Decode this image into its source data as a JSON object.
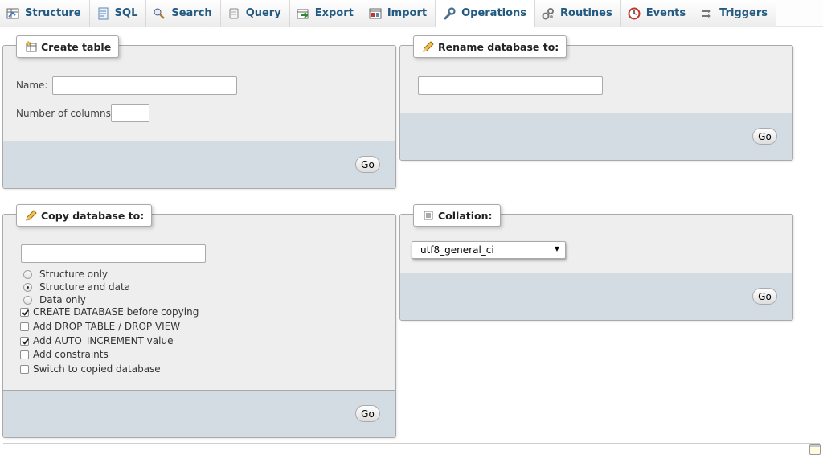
{
  "tabs": [
    {
      "label": "Structure",
      "icon": "structure-icon"
    },
    {
      "label": "SQL",
      "icon": "sql-icon"
    },
    {
      "label": "Search",
      "icon": "search-icon"
    },
    {
      "label": "Query",
      "icon": "query-icon"
    },
    {
      "label": "Export",
      "icon": "export-icon"
    },
    {
      "label": "Import",
      "icon": "import-icon"
    },
    {
      "label": "Operations",
      "icon": "wrench-icon",
      "active": true
    },
    {
      "label": "Routines",
      "icon": "routines-icon"
    },
    {
      "label": "Events",
      "icon": "clock-icon"
    },
    {
      "label": "Triggers",
      "icon": "triggers-icon"
    }
  ],
  "create_table": {
    "legend": "Create table",
    "name_label": "Name:",
    "name_value": "",
    "columns_label": "Number of columns:",
    "columns_value": "",
    "go": "Go"
  },
  "rename_db": {
    "legend": "Rename database to:",
    "value": "",
    "go": "Go"
  },
  "copy_db": {
    "legend": "Copy database to:",
    "value": "",
    "radios": [
      {
        "label": "Structure only",
        "checked": false
      },
      {
        "label": "Structure and data",
        "checked": true
      },
      {
        "label": "Data only",
        "checked": false
      }
    ],
    "checkboxes": [
      {
        "label": "CREATE DATABASE before copying",
        "checked": true
      },
      {
        "label": "Add DROP TABLE / DROP VIEW",
        "checked": false
      },
      {
        "label": "Add AUTO_INCREMENT value",
        "checked": true
      },
      {
        "label": "Add constraints",
        "checked": false
      },
      {
        "label": "Switch to copied database",
        "checked": false
      }
    ],
    "go": "Go"
  },
  "collation": {
    "legend": "Collation:",
    "selected": "utf8_general_ci",
    "go": "Go"
  },
  "colors": {
    "tab_text": "#235a81",
    "panel_bg": "#eeeeee",
    "footer_bg": "#d3dce3",
    "border": "#aaaaaa"
  }
}
